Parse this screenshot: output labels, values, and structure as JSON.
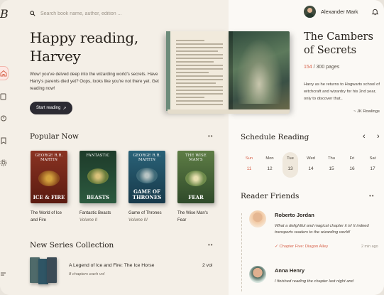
{
  "colors": {
    "accent": "#d7624a",
    "dark_button": "#2c2b33",
    "background": "#f4efe7",
    "panel": "#fbf9f5"
  },
  "logo": "B",
  "rail": {
    "icons": [
      "home-icon",
      "book-icon",
      "timer-icon",
      "bookmark-icon",
      "gear-icon",
      "menu-icon"
    ]
  },
  "search": {
    "placeholder": "Search book name, author, edition ..."
  },
  "user": {
    "name": "Alexander Mark"
  },
  "hero": {
    "title": "Happy reading, Harvey",
    "text": "Wow! you've delved deep into the wizarding world's secrets. Have Harry's parents died yet? Oops, looks like you're not there yet. Get reading now!",
    "button": "Start reading",
    "button_icon": "↗"
  },
  "current_book": {
    "title": "The Cambers of Secrets",
    "pages_read": "154",
    "pages_total": "/ 300 pages",
    "description": "Harry as he returns to Hogwarts school of witchcraft and wizardry for his 2nd year, only to discover that..",
    "author": "~ JK Rowlings"
  },
  "popular": {
    "title": "Popular Now",
    "more": "••",
    "books": [
      {
        "title": "The World of Ice and Fire",
        "subtitle": "",
        "cover_top": "GEORGE R.R. MARTIN",
        "cover_bottom": "ICE & FIRE",
        "color": "#7a2a1c"
      },
      {
        "title": "Fantastic Beasts",
        "subtitle": "Volume II",
        "cover_top": "FANTASTIC",
        "cover_bottom": "BEASTS",
        "color": "#274a36"
      },
      {
        "title": "Game of Thrones",
        "subtitle": "Volume III",
        "cover_top": "GEORGE R.R. MARTIN",
        "cover_bottom": "GAME OF THRONES",
        "color": "#1f4f63"
      },
      {
        "title": "The Wise Man's Fear",
        "subtitle": "",
        "cover_top": "THE WISE MAN'S",
        "cover_bottom": "FEAR",
        "color": "#3c5d3a"
      }
    ]
  },
  "series": {
    "title": "New Series Collection",
    "more": "••",
    "item": {
      "title": "A Legend of Ice and Fire: The Ice Horse",
      "subtitle": "8 chapters each vol",
      "volumes": "2 vol"
    }
  },
  "schedule": {
    "title": "Schedule Reading",
    "prev": "‹",
    "next": "›",
    "days": [
      {
        "day": "Sun",
        "date": "11",
        "highlight": "red"
      },
      {
        "day": "Mon",
        "date": "12",
        "highlight": ""
      },
      {
        "day": "Tue",
        "date": "13",
        "highlight": "selected"
      },
      {
        "day": "Wed",
        "date": "14",
        "highlight": ""
      },
      {
        "day": "Thu",
        "date": "15",
        "highlight": ""
      },
      {
        "day": "Fri",
        "date": "16",
        "highlight": ""
      },
      {
        "day": "Sat",
        "date": "17",
        "highlight": ""
      }
    ]
  },
  "friends": {
    "title": "Reader Friends",
    "more": "••",
    "items": [
      {
        "name": "Roberto Jordan",
        "message": "What a delightful and magical chapter it is! It indeed transports readers to the wizarding world!",
        "chapter": "Chapter Five: Diagon Alley",
        "time": "2 min ago"
      },
      {
        "name": "Anna Henry",
        "message": "I finished reading the chapter last night and",
        "chapter": "",
        "time": ""
      }
    ]
  }
}
